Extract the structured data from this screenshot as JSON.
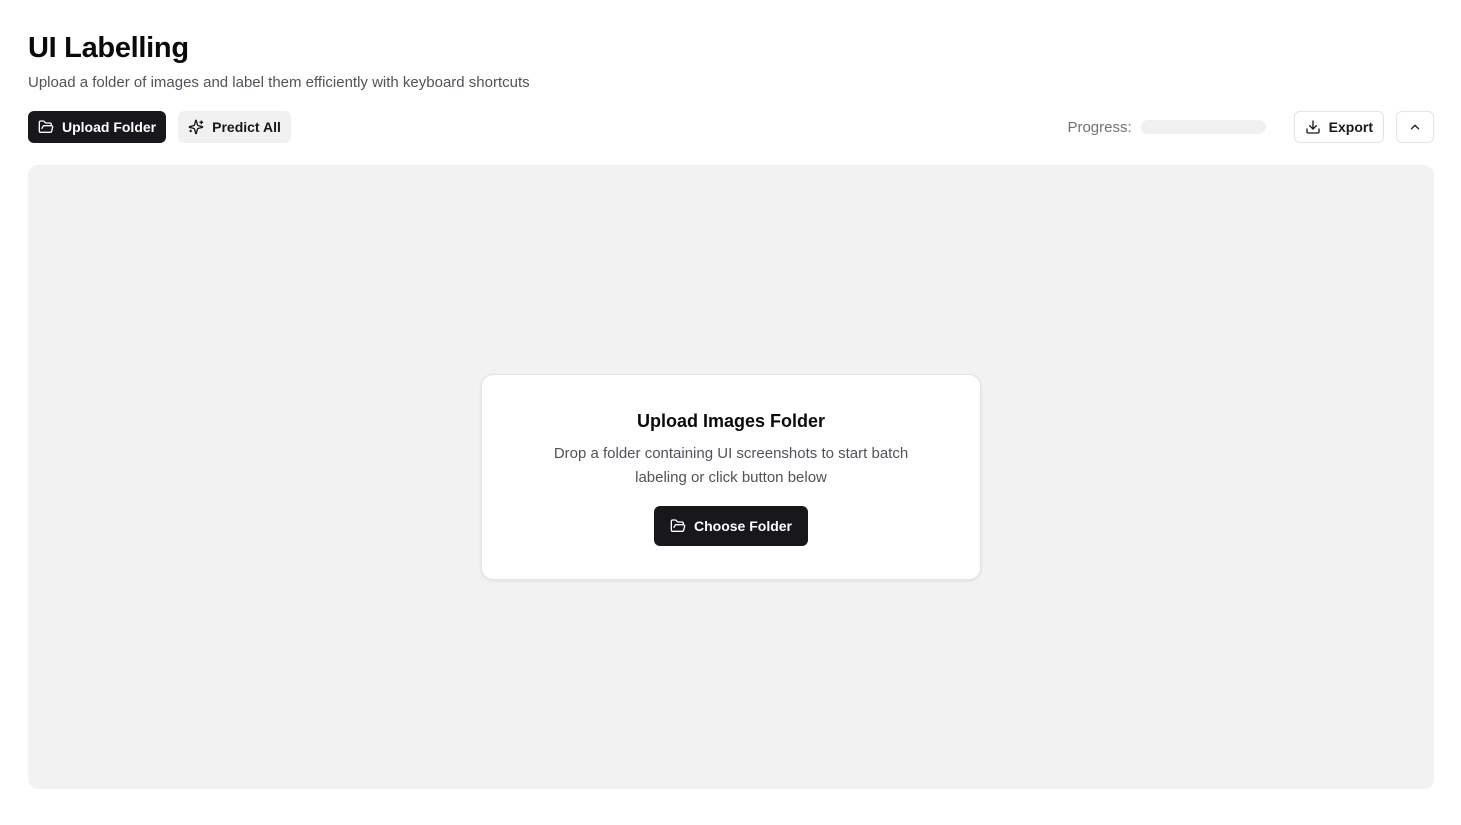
{
  "header": {
    "title": "UI Labelling",
    "subtitle": "Upload a folder of images and label them efficiently with keyboard shortcuts"
  },
  "toolbar": {
    "upload_folder_label": "Upload Folder",
    "upload_folder_icon": "folder-open-icon",
    "predict_all_label": "Predict All",
    "predict_all_icon": "sparkles-icon",
    "progress_label": "Progress:",
    "progress_value": 0,
    "export_label": "Export",
    "export_icon": "download-icon",
    "collapse_icon": "chevron-up-icon"
  },
  "dropzone": {
    "card_title": "Upload Images Folder",
    "card_description": "Drop a folder containing UI screenshots to start batch labeling or click button below",
    "choose_folder_label": "Choose Folder",
    "choose_folder_icon": "folder-open-icon"
  },
  "colors": {
    "primary": "#18181b",
    "muted_text": "#52525b",
    "dropzone_bg": "#f2f2f2",
    "secondary_bg": "#f1f1f1",
    "border": "#e4e4e7"
  }
}
